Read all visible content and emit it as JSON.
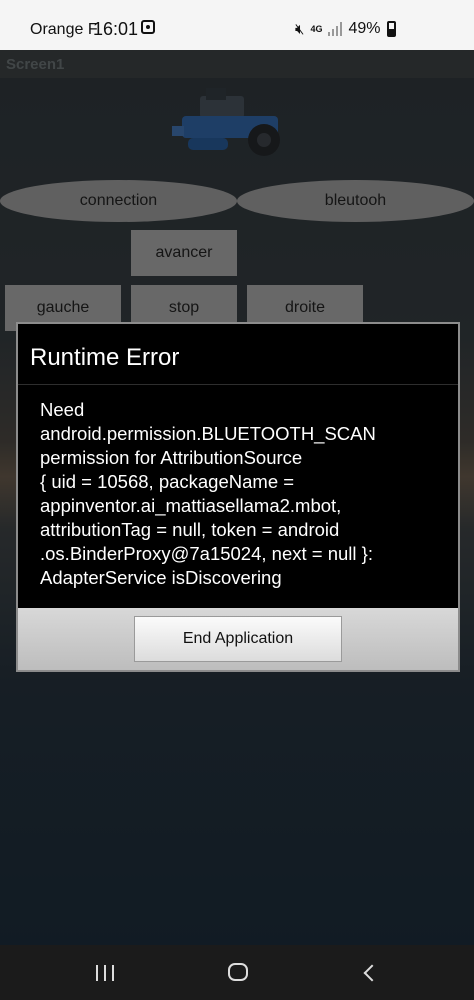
{
  "status_bar": {
    "carrier": "Orange F",
    "time": "16:01",
    "network": "4G",
    "battery": "49%"
  },
  "app": {
    "screen_title": "Screen1",
    "buttons": {
      "connection": "connection",
      "bluetooth": "bleutooh",
      "forward": "avancer",
      "left": "gauche",
      "stop": "stop",
      "right": "droite"
    }
  },
  "dialog": {
    "title": "Runtime Error",
    "message": "Need\nandroid.permission.BLUETOOTH_SCAN\npermission for AttributionSource\n{ uid = 10568, packageName =\nappinventor.ai_mattiasellama2.mbot,\nattributionTag = null, token = android\n.os.BinderProxy@7a15024, next = null }:\nAdapterService isDiscovering",
    "button": "End Application"
  },
  "icons": [
    "notification-icon",
    "mute-icon",
    "signal-icon",
    "battery-icon",
    "robot-image",
    "recent-apps-icon",
    "home-icon",
    "back-icon"
  ]
}
